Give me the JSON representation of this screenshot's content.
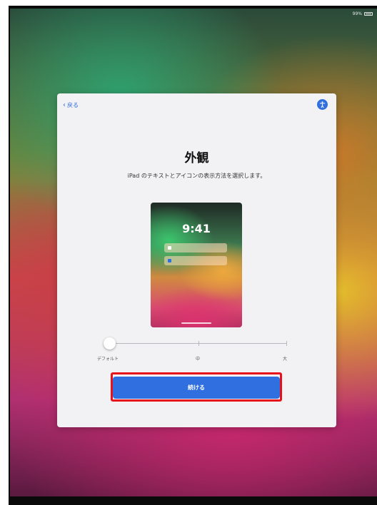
{
  "status": {
    "battery_text": "99%"
  },
  "panel": {
    "back_label": "戻る",
    "title": "外観",
    "subtitle": "iPad のテキストとアイコンの表示方法を選択します。",
    "preview_time": "9:41",
    "slider": {
      "labels": [
        "デフォルト",
        "中",
        "大"
      ],
      "level": 0
    },
    "continue_label": "続ける"
  },
  "colors": {
    "accent": "#2f6fe0",
    "highlight": "#e8101a"
  },
  "icons": {
    "back": "chevron-left-icon",
    "accessibility": "accessibility-icon"
  }
}
